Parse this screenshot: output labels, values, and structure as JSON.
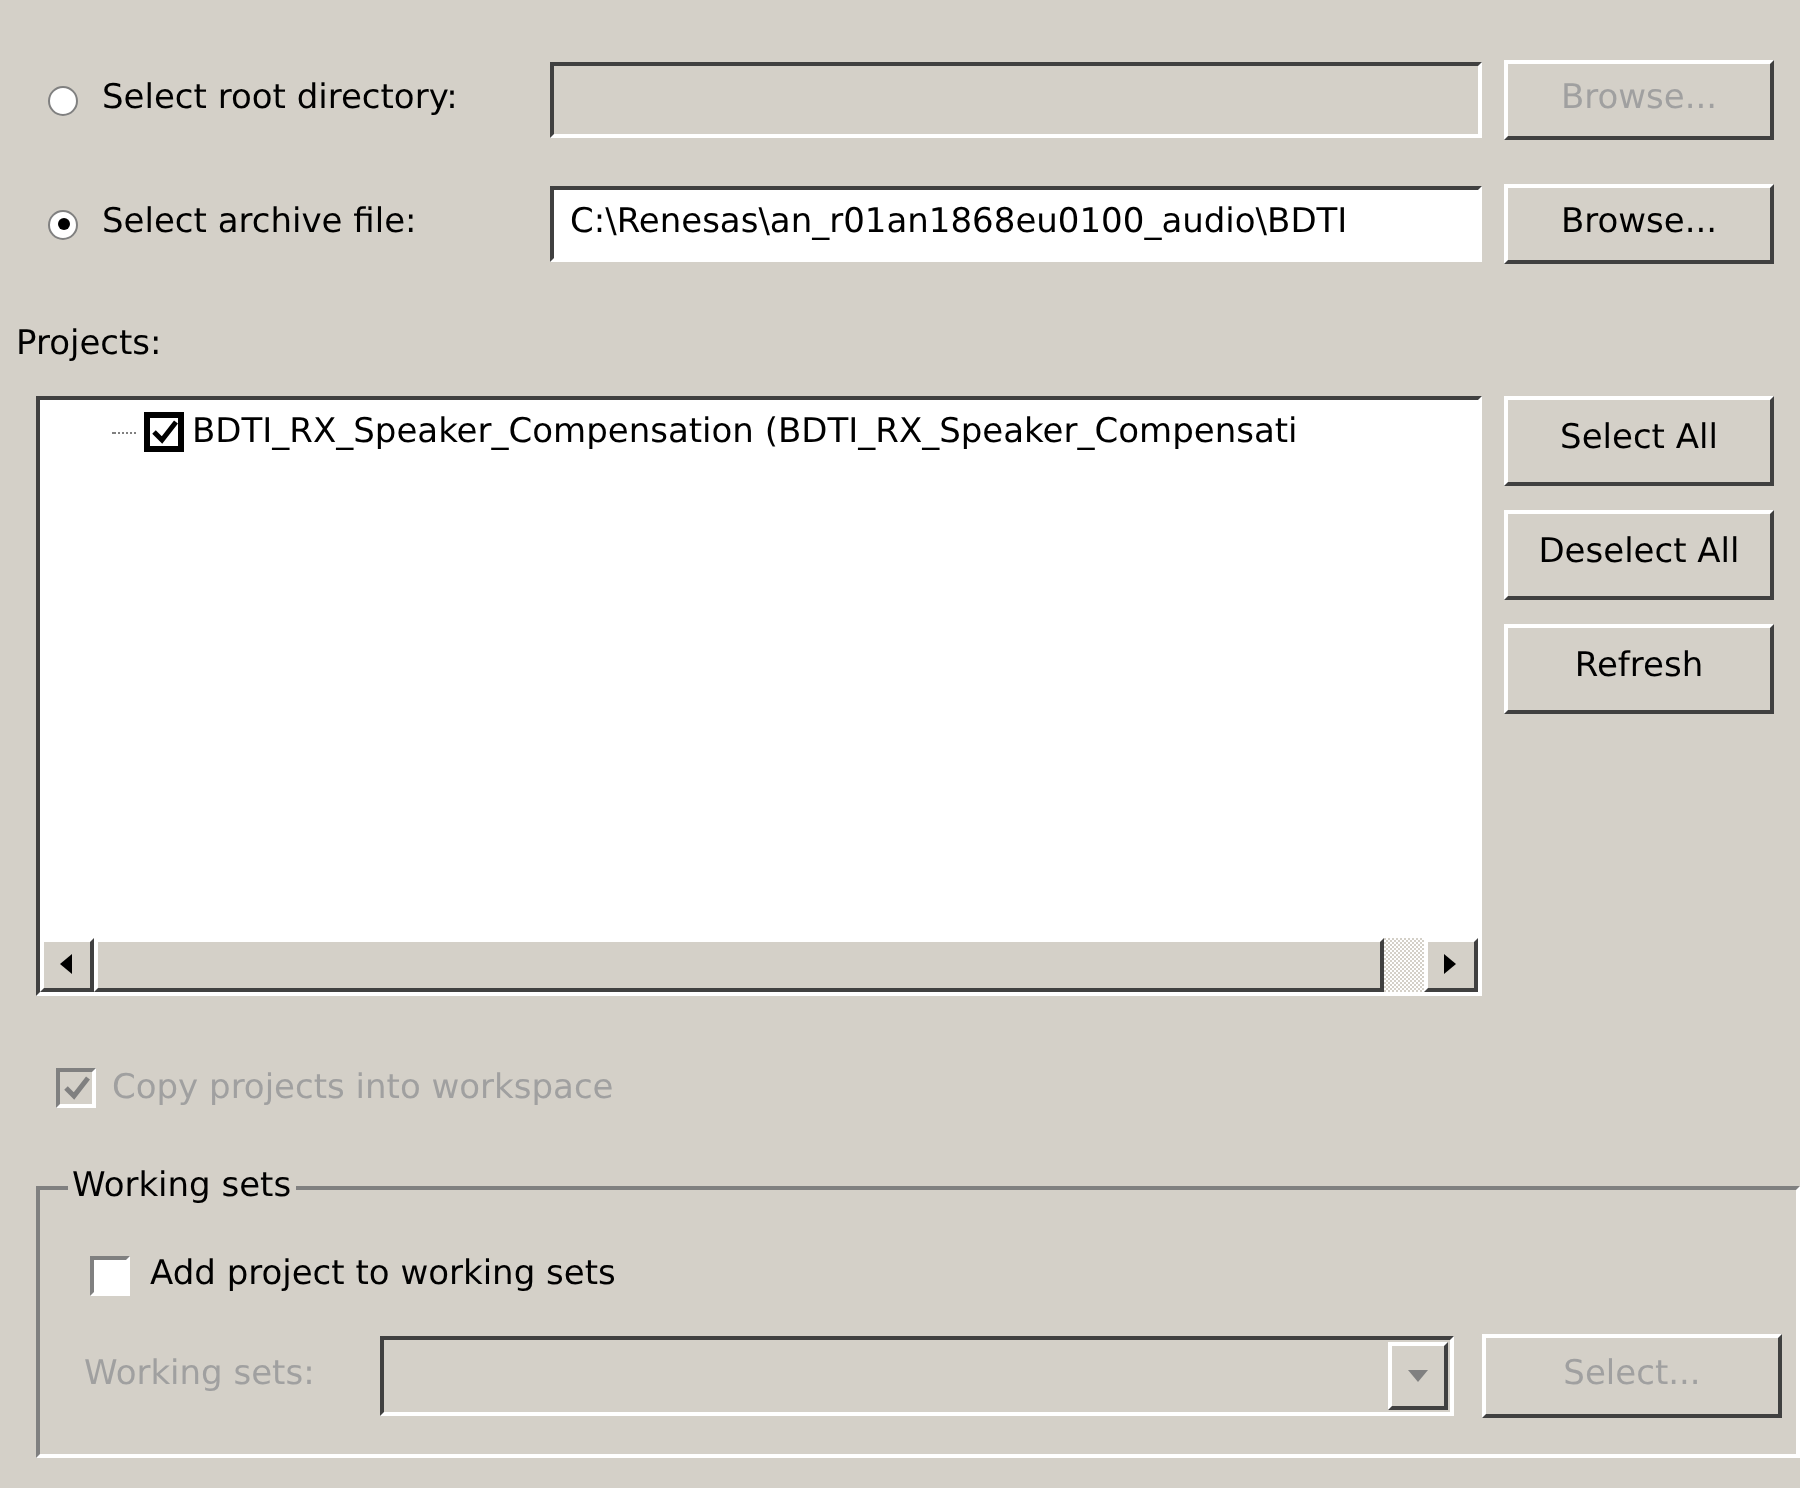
{
  "source": {
    "options": [
      {
        "label": "Select root directory:",
        "selected": false,
        "browse": "Browse...",
        "disabled": true
      },
      {
        "label": "Select archive file:",
        "selected": true,
        "path": "C:\\Renesas\\an_r01an1868eu0100_audio\\BDTI",
        "browse": "Browse...",
        "disabled": false
      }
    ]
  },
  "projects": {
    "label": "Projects:",
    "items": [
      {
        "label": "BDTI_RX_Speaker_Compensation (BDTI_RX_Speaker_Compensati",
        "checked": true
      }
    ],
    "buttons": [
      "Select All",
      "Deselect All",
      "Refresh"
    ]
  },
  "copy_option": {
    "label": "Copy projects into workspace",
    "checked": true,
    "disabled": true
  },
  "working_sets": {
    "title": "Working sets",
    "add": {
      "label": "Add project to working sets",
      "checked": false
    },
    "field_label": "Working sets:",
    "select_button": "Select...",
    "disabled": true
  }
}
